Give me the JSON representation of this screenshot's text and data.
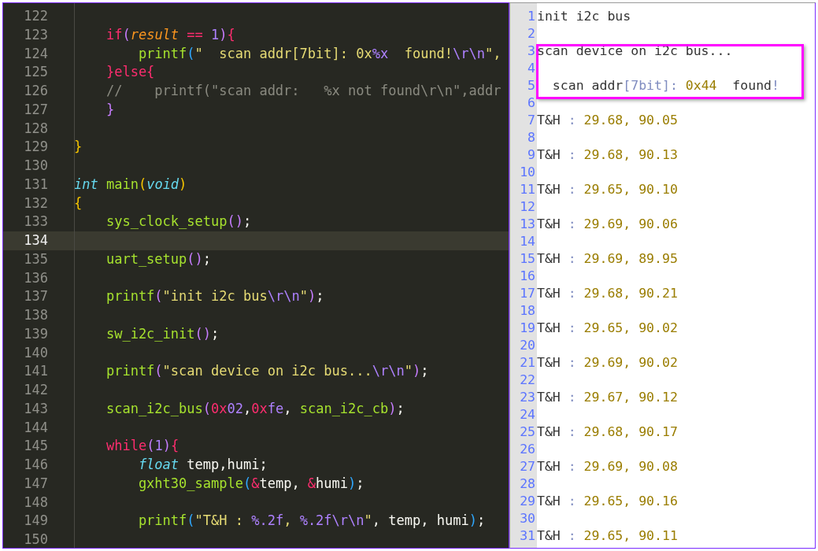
{
  "editor": {
    "lines": [
      {
        "num": "122",
        "current": false
      },
      {
        "num": "123",
        "current": false,
        "tokens": [
          {
            "t": "    if",
            "kind": "kw"
          },
          {
            "t": "(",
            "kind": "p"
          },
          {
            "t": "result",
            "kind": "param"
          },
          {
            "t": " == ",
            "kind": "kw"
          },
          {
            "t": "1",
            "kind": "num"
          },
          {
            "t": ")",
            "kind": "p"
          },
          {
            "t": "{",
            "kind": "kw"
          }
        ]
      },
      {
        "num": "124",
        "current": false,
        "tokens": [
          {
            "t": "        printf",
            "kind": "fn"
          },
          {
            "t": "(",
            "kind": "b"
          },
          {
            "t": "\"  scan addr[7bit]: 0x",
            "kind": "str"
          },
          {
            "t": "%x",
            "kind": "esc"
          },
          {
            "t": "  found!",
            "kind": "str"
          },
          {
            "t": "\\r\\n",
            "kind": "esc"
          },
          {
            "t": "\",",
            "kind": "str"
          }
        ]
      },
      {
        "num": "125",
        "current": false,
        "tokens": [
          {
            "t": "    }else{",
            "kind": "kw"
          }
        ]
      },
      {
        "num": "126",
        "current": false,
        "tokens": [
          {
            "t": "    //    printf(\"scan addr:   %x not found\\r\\n\",addr",
            "kind": "comment"
          }
        ]
      },
      {
        "num": "127",
        "current": false,
        "tokens": [
          {
            "t": "    }",
            "kind": "p"
          }
        ]
      },
      {
        "num": "128",
        "current": false
      },
      {
        "num": "129",
        "current": false,
        "tokens": [
          {
            "t": "}",
            "kind": "y"
          }
        ]
      },
      {
        "num": "130",
        "current": false
      },
      {
        "num": "131",
        "current": false,
        "tokens": [
          {
            "t": "int",
            "kind": "type"
          },
          {
            "t": " main",
            "kind": "fn"
          },
          {
            "t": "(",
            "kind": "y"
          },
          {
            "t": "void",
            "kind": "type"
          },
          {
            "t": ")",
            "kind": "y"
          }
        ]
      },
      {
        "num": "132",
        "current": false,
        "tokens": [
          {
            "t": "{",
            "kind": "y"
          }
        ]
      },
      {
        "num": "133",
        "current": false,
        "tokens": [
          {
            "t": "    sys_clock_setup",
            "kind": "fn"
          },
          {
            "t": "()",
            "kind": "p"
          },
          {
            "t": ";",
            "kind": "w"
          }
        ]
      },
      {
        "num": "134",
        "current": true
      },
      {
        "num": "135",
        "current": false,
        "tokens": [
          {
            "t": "    uart_setup",
            "kind": "fn"
          },
          {
            "t": "()",
            "kind": "p"
          },
          {
            "t": ";",
            "kind": "w"
          }
        ]
      },
      {
        "num": "136",
        "current": false
      },
      {
        "num": "137",
        "current": false,
        "tokens": [
          {
            "t": "    printf",
            "kind": "fn"
          },
          {
            "t": "(",
            "kind": "p"
          },
          {
            "t": "\"init i2c bus",
            "kind": "str"
          },
          {
            "t": "\\r\\n",
            "kind": "esc"
          },
          {
            "t": "\"",
            "kind": "str"
          },
          {
            "t": ")",
            "kind": "p"
          },
          {
            "t": ";",
            "kind": "w"
          }
        ]
      },
      {
        "num": "138",
        "current": false
      },
      {
        "num": "139",
        "current": false,
        "tokens": [
          {
            "t": "    sw_i2c_init",
            "kind": "fn"
          },
          {
            "t": "()",
            "kind": "p"
          },
          {
            "t": ";",
            "kind": "w"
          }
        ]
      },
      {
        "num": "140",
        "current": false
      },
      {
        "num": "141",
        "current": false,
        "tokens": [
          {
            "t": "    printf",
            "kind": "fn"
          },
          {
            "t": "(",
            "kind": "p"
          },
          {
            "t": "\"scan device on i2c bus...",
            "kind": "str"
          },
          {
            "t": "\\r\\n",
            "kind": "esc"
          },
          {
            "t": "\"",
            "kind": "str"
          },
          {
            "t": ")",
            "kind": "p"
          },
          {
            "t": ";",
            "kind": "w"
          }
        ]
      },
      {
        "num": "142",
        "current": false
      },
      {
        "num": "143",
        "current": false,
        "tokens": [
          {
            "t": "    scan_i2c_bus",
            "kind": "fn"
          },
          {
            "t": "(",
            "kind": "p"
          },
          {
            "t": "0x",
            "kind": "r"
          },
          {
            "t": "02",
            "kind": "num"
          },
          {
            "t": ",",
            "kind": "w"
          },
          {
            "t": "0x",
            "kind": "r"
          },
          {
            "t": "fe",
            "kind": "num"
          },
          {
            "t": ", ",
            "kind": "w"
          },
          {
            "t": "scan_i2c_cb",
            "kind": "fn"
          },
          {
            "t": ")",
            "kind": "p"
          },
          {
            "t": ";",
            "kind": "w"
          }
        ]
      },
      {
        "num": "144",
        "current": false
      },
      {
        "num": "145",
        "current": false,
        "tokens": [
          {
            "t": "    while",
            "kind": "kw"
          },
          {
            "t": "(",
            "kind": "p"
          },
          {
            "t": "1",
            "kind": "num"
          },
          {
            "t": ")",
            "kind": "p"
          },
          {
            "t": "{",
            "kind": "kw"
          }
        ]
      },
      {
        "num": "146",
        "current": false,
        "tokens": [
          {
            "t": "        float",
            "kind": "type"
          },
          {
            "t": " temp,humi;",
            "kind": "w"
          }
        ]
      },
      {
        "num": "147",
        "current": false,
        "tokens": [
          {
            "t": "        gxht30_sample",
            "kind": "fn"
          },
          {
            "t": "(",
            "kind": "b"
          },
          {
            "t": "&",
            "kind": "r"
          },
          {
            "t": "temp, ",
            "kind": "w"
          },
          {
            "t": "&",
            "kind": "r"
          },
          {
            "t": "humi",
            "kind": "w"
          },
          {
            "t": ")",
            "kind": "b"
          },
          {
            "t": ";",
            "kind": "w"
          }
        ]
      },
      {
        "num": "148",
        "current": false
      },
      {
        "num": "149",
        "current": false,
        "tokens": [
          {
            "t": "        printf",
            "kind": "fn"
          },
          {
            "t": "(",
            "kind": "b"
          },
          {
            "t": "\"T&H : ",
            "kind": "str"
          },
          {
            "t": "%.2f",
            "kind": "esc"
          },
          {
            "t": ", ",
            "kind": "str"
          },
          {
            "t": "%.2f",
            "kind": "esc"
          },
          {
            "t": "\\r\\n",
            "kind": "esc"
          },
          {
            "t": "\"",
            "kind": "str"
          },
          {
            "t": ", temp, humi",
            "kind": "w"
          },
          {
            "t": ")",
            "kind": "b"
          },
          {
            "t": ";",
            "kind": "w"
          }
        ]
      },
      {
        "num": "150",
        "current": false
      }
    ]
  },
  "output": {
    "lines": [
      {
        "num": "1",
        "highlighted": false,
        "tokens": [
          {
            "t": "init i2c bus",
            "kind": "text"
          }
        ]
      },
      {
        "num": "2",
        "highlighted": false
      },
      {
        "num": "3",
        "highlighted": true,
        "tokens": [
          {
            "t": "scan device on i2c bus...",
            "kind": "text"
          }
        ]
      },
      {
        "num": "4",
        "highlighted": true
      },
      {
        "num": "5",
        "highlighted": true,
        "tokens": [
          {
            "t": "  scan addr",
            "kind": "text"
          },
          {
            "t": "[7bit]:",
            "kind": "mark"
          },
          {
            "t": " 0x44",
            "kind": "value"
          },
          {
            "t": "  found",
            "kind": "text"
          },
          {
            "t": "!",
            "kind": "mark"
          }
        ]
      },
      {
        "num": "6",
        "highlighted": false
      },
      {
        "num": "7",
        "highlighted": false,
        "tokens": [
          {
            "t": "T&H ",
            "kind": "text"
          },
          {
            "t": ":",
            "kind": "mark"
          },
          {
            "t": " 29.68, 90.05",
            "kind": "value"
          }
        ]
      },
      {
        "num": "8",
        "highlighted": false
      },
      {
        "num": "9",
        "highlighted": false,
        "tokens": [
          {
            "t": "T&H ",
            "kind": "text"
          },
          {
            "t": ":",
            "kind": "mark"
          },
          {
            "t": " 29.68, 90.13",
            "kind": "value"
          }
        ]
      },
      {
        "num": "10",
        "highlighted": false
      },
      {
        "num": "11",
        "highlighted": false,
        "tokens": [
          {
            "t": "T&H ",
            "kind": "text"
          },
          {
            "t": ":",
            "kind": "mark"
          },
          {
            "t": " 29.65, 90.10",
            "kind": "value"
          }
        ]
      },
      {
        "num": "12",
        "highlighted": false
      },
      {
        "num": "13",
        "highlighted": false,
        "tokens": [
          {
            "t": "T&H ",
            "kind": "text"
          },
          {
            "t": ":",
            "kind": "mark"
          },
          {
            "t": " 29.69, 90.06",
            "kind": "value"
          }
        ]
      },
      {
        "num": "14",
        "highlighted": false
      },
      {
        "num": "15",
        "highlighted": false,
        "tokens": [
          {
            "t": "T&H ",
            "kind": "text"
          },
          {
            "t": ":",
            "kind": "mark"
          },
          {
            "t": " 29.69, 89.95",
            "kind": "value"
          }
        ]
      },
      {
        "num": "16",
        "highlighted": false
      },
      {
        "num": "17",
        "highlighted": false,
        "tokens": [
          {
            "t": "T&H ",
            "kind": "text"
          },
          {
            "t": ":",
            "kind": "mark"
          },
          {
            "t": " 29.68, 90.21",
            "kind": "value"
          }
        ]
      },
      {
        "num": "18",
        "highlighted": false
      },
      {
        "num": "19",
        "highlighted": false,
        "tokens": [
          {
            "t": "T&H ",
            "kind": "text"
          },
          {
            "t": ":",
            "kind": "mark"
          },
          {
            "t": " 29.65, 90.02",
            "kind": "value"
          }
        ]
      },
      {
        "num": "20",
        "highlighted": false
      },
      {
        "num": "21",
        "highlighted": false,
        "tokens": [
          {
            "t": "T&H ",
            "kind": "text"
          },
          {
            "t": ":",
            "kind": "mark"
          },
          {
            "t": " 29.69, 90.02",
            "kind": "value"
          }
        ]
      },
      {
        "num": "22",
        "highlighted": false
      },
      {
        "num": "23",
        "highlighted": false,
        "tokens": [
          {
            "t": "T&H ",
            "kind": "text"
          },
          {
            "t": ":",
            "kind": "mark"
          },
          {
            "t": " 29.67, 90.12",
            "kind": "value"
          }
        ]
      },
      {
        "num": "24",
        "highlighted": false
      },
      {
        "num": "25",
        "highlighted": false,
        "tokens": [
          {
            "t": "T&H ",
            "kind": "text"
          },
          {
            "t": ":",
            "kind": "mark"
          },
          {
            "t": " 29.68, 90.17",
            "kind": "value"
          }
        ]
      },
      {
        "num": "26",
        "highlighted": false
      },
      {
        "num": "27",
        "highlighted": false,
        "tokens": [
          {
            "t": "T&H ",
            "kind": "text"
          },
          {
            "t": ":",
            "kind": "mark"
          },
          {
            "t": " 29.69, 90.08",
            "kind": "value"
          }
        ]
      },
      {
        "num": "28",
        "highlighted": false
      },
      {
        "num": "29",
        "highlighted": false,
        "tokens": [
          {
            "t": "T&H ",
            "kind": "text"
          },
          {
            "t": ":",
            "kind": "mark"
          },
          {
            "t": " 29.65, 90.16",
            "kind": "value"
          }
        ]
      },
      {
        "num": "30",
        "highlighted": false
      },
      {
        "num": "31",
        "highlighted": false,
        "tokens": [
          {
            "t": "T&H ",
            "kind": "text"
          },
          {
            "t": ":",
            "kind": "mark"
          },
          {
            "t": " 29.65, 90.11",
            "kind": "value"
          }
        ]
      }
    ]
  }
}
